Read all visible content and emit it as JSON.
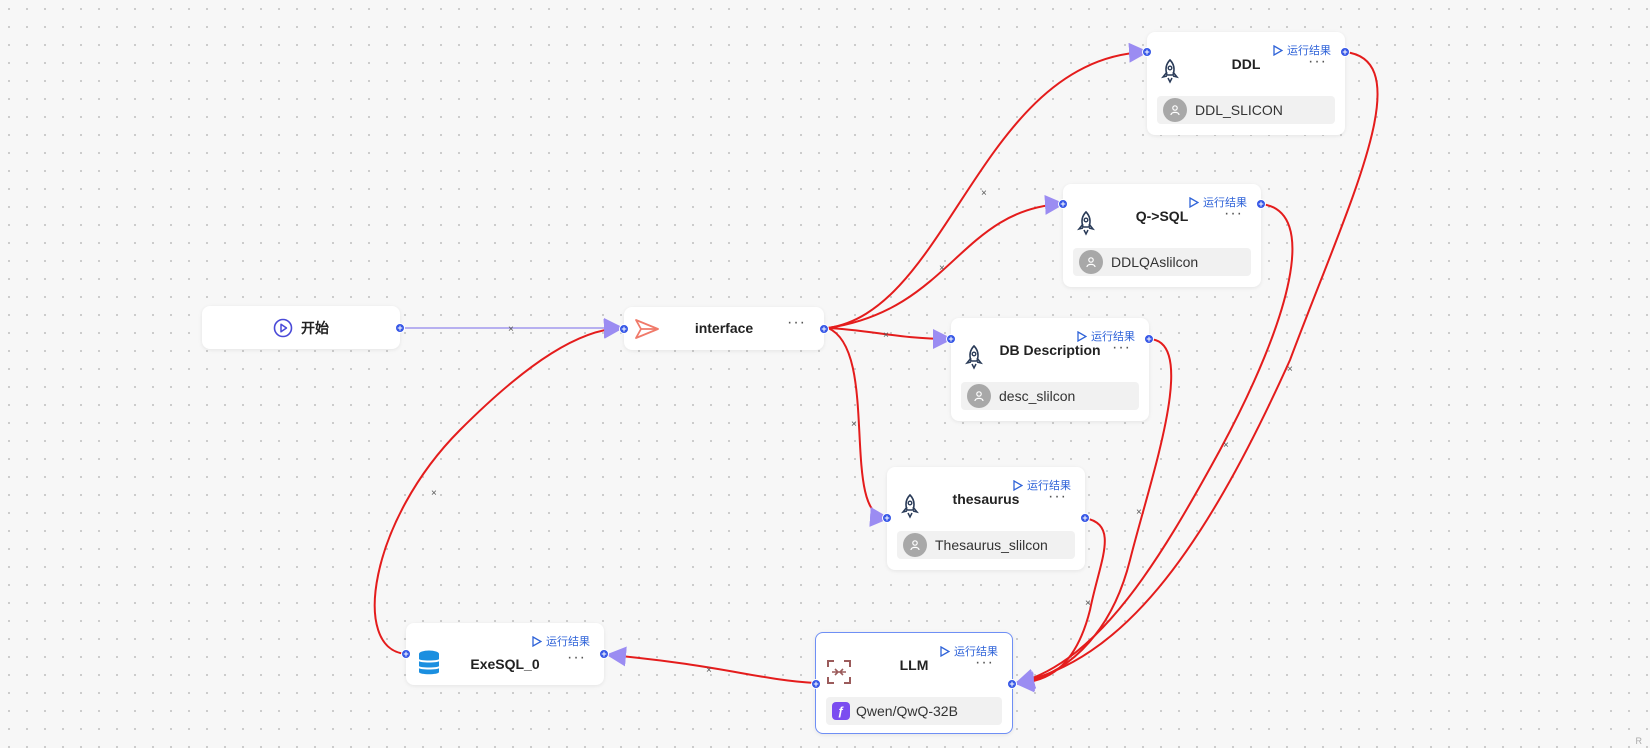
{
  "colors": {
    "edge_red": "#e41c1c",
    "edge_lavender": "#b7b0f0",
    "handle": "#3556e6",
    "run_link": "#2f63d8"
  },
  "run_label": "运行结果",
  "nodes": {
    "start": {
      "title": "开始",
      "icon": "play-circle-icon"
    },
    "interface": {
      "title": "interface",
      "icon": "send-icon"
    },
    "ddl": {
      "title": "DDL",
      "icon": "rocket-icon",
      "sub": "DDL_SLICON"
    },
    "qsql": {
      "title": "Q->SQL",
      "icon": "rocket-icon",
      "sub": "DDLQAslilcon"
    },
    "dbdesc": {
      "title": "DB Description",
      "icon": "rocket-icon",
      "sub": "desc_slilcon"
    },
    "thesaurus": {
      "title": "thesaurus",
      "icon": "rocket-icon",
      "sub": "Thesaurus_slilcon"
    },
    "exesql": {
      "title": "ExeSQL_0",
      "icon": "database-icon"
    },
    "llm": {
      "title": "LLM",
      "icon": "llm-icon",
      "sub": "Qwen/QwQ-32B"
    }
  },
  "corner_mark": "R"
}
